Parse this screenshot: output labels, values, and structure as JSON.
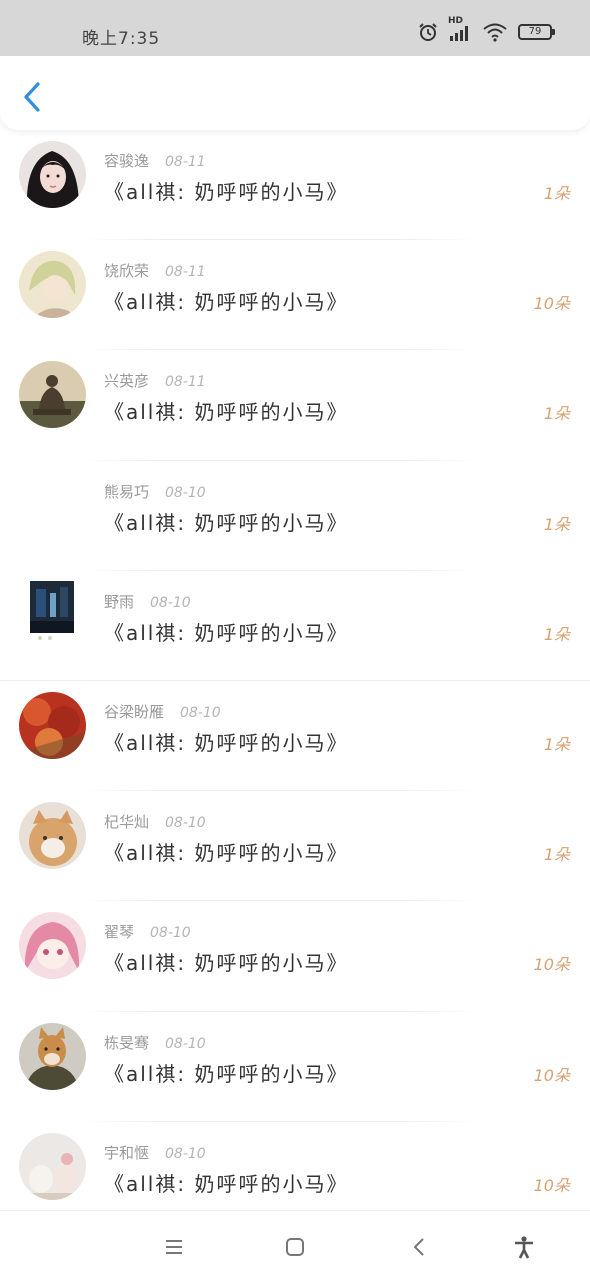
{
  "status_bar": {
    "time": "晚上7:35",
    "network_label": "HD",
    "battery": "79",
    "icons": [
      "alarm-icon",
      "signal-icon",
      "wifi-icon",
      "battery-icon"
    ]
  },
  "header": {
    "back_icon": "chevron-left-icon"
  },
  "list": {
    "rows": [
      {
        "name": "容骏逸",
        "date": "08-11",
        "title": "《all祺:  奶呼呼的小马》",
        "count": "1朵"
      },
      {
        "name": "饶欣荣",
        "date": "08-11",
        "title": "《all祺:  奶呼呼的小马》",
        "count": "10朵"
      },
      {
        "name": "兴英彦",
        "date": "08-11",
        "title": "《all祺:  奶呼呼的小马》",
        "count": "1朵"
      },
      {
        "name": "熊易巧",
        "date": "08-10",
        "title": "《all祺:  奶呼呼的小马》",
        "count": "1朵"
      },
      {
        "name": "野雨",
        "date": "08-10",
        "title": "《all祺:  奶呼呼的小马》",
        "count": "1朵"
      },
      {
        "name": "谷梁盼雁",
        "date": "08-10",
        "title": "《all祺:  奶呼呼的小马》",
        "count": "1朵"
      },
      {
        "name": "杞华灿",
        "date": "08-10",
        "title": "《all祺:  奶呼呼的小马》",
        "count": "1朵"
      },
      {
        "name": "翟琴",
        "date": "08-10",
        "title": "《all祺:  奶呼呼的小马》",
        "count": "10朵"
      },
      {
        "name": "栋旻骞",
        "date": "08-10",
        "title": "《all祺:  奶呼呼的小马》",
        "count": "10朵"
      },
      {
        "name": "宇和惬",
        "date": "08-10",
        "title": "《all祺:  奶呼呼的小马》",
        "count": "10朵"
      }
    ]
  },
  "nav_bar": {
    "icons": [
      "menu-icon",
      "home-square-icon",
      "back-triangle-icon",
      "accessibility-icon"
    ]
  },
  "colors": {
    "accent": "#2f8fe0",
    "count": "#d7a273",
    "status_bg": "#d7d7d7"
  }
}
